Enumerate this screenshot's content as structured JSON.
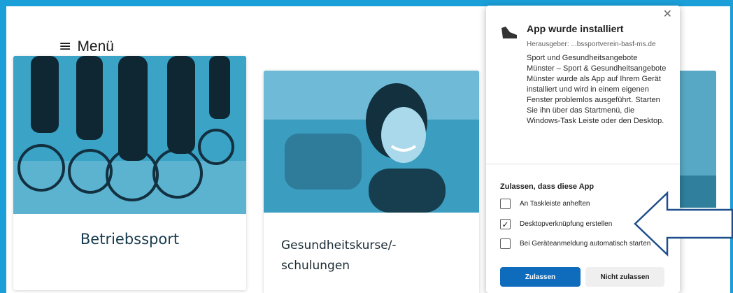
{
  "menu": {
    "icon": "hamburger-icon",
    "label": "Menü"
  },
  "cards": [
    {
      "title": "Betriebssport",
      "image": "cyclists-photo"
    },
    {
      "title": "Gesundheitskurse/-schulungen",
      "image": "smiling-woman-photo"
    },
    {
      "title": "",
      "image": "partial-photo"
    }
  ],
  "popup": {
    "close_icon": "close-icon",
    "app_icon": "shoe-icon",
    "title": "App wurde installiert",
    "publisher": "Herausgeber: ...bssportverein-basf-ms.de",
    "description": "Sport und Gesundheitsangebote Münster – Sport & Gesundheitsangebote Münster wurde als App auf Ihrem Gerät installiert und wird in einem eigenen Fenster problemlos ausgeführt. Starten Sie ihn über das Startmenü, die Windows-Task Leiste oder den Desktop.",
    "section_title": "Zulassen, dass diese App",
    "options": [
      {
        "label": "An Taskleiste anheften",
        "checked": false
      },
      {
        "label": "Desktopverknüpfung erstellen",
        "checked": true
      },
      {
        "label": "Bei Geräteanmeldung automatisch starten",
        "checked": false
      }
    ],
    "allow_button": "Zulassen",
    "deny_button": "Nicht zulassen"
  },
  "colors": {
    "page_border": "#1a9fd8",
    "primary_button": "#0f6cbd",
    "photo_tint": "#3aa3c6",
    "arrow": "#1e4f8c"
  }
}
